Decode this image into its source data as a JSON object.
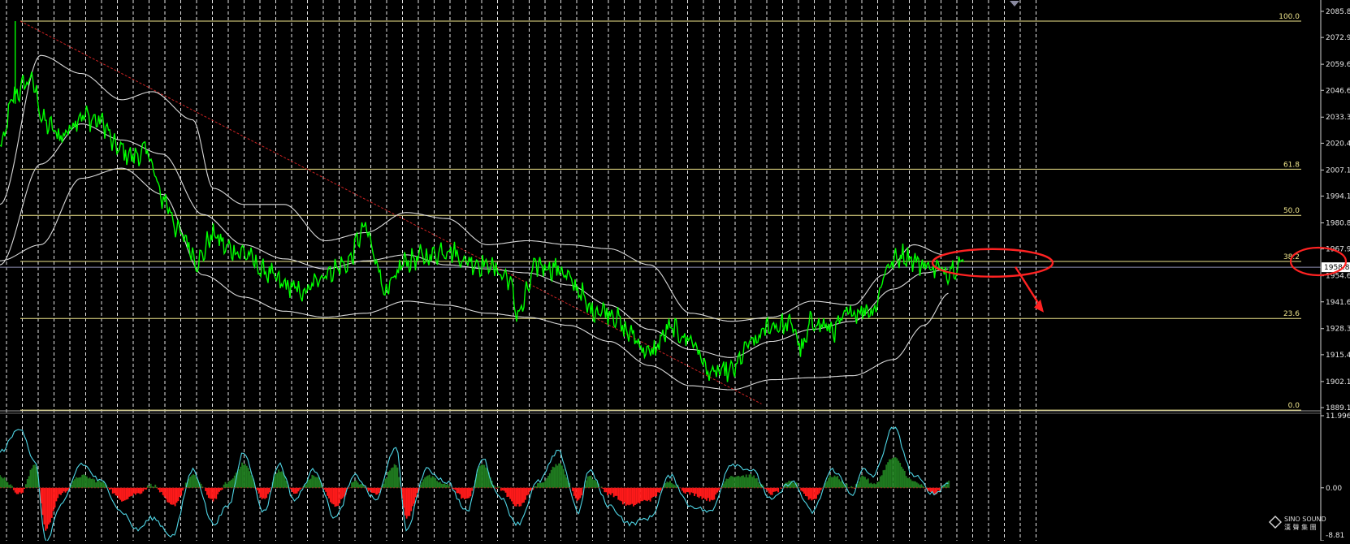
{
  "chart_data": [
    {
      "type": "line",
      "name": "price-panel",
      "ylim": [
        1889.15,
        2085.85
      ],
      "y_ticks": [
        "2085.85",
        "2072.90",
        "2059.60",
        "2046.65",
        "2033.35",
        "2020.40",
        "2007.10",
        "1994.15",
        "1980.85",
        "1967.90",
        "1954.60",
        "1941.65",
        "1928.35",
        "1915.40",
        "1902.10",
        "1889.15"
      ],
      "current_price": "1958.83",
      "fib_levels": [
        {
          "label": "100.0",
          "value": 2081.0
        },
        {
          "label": "61.8",
          "value": 2007.5
        },
        {
          "label": "50.0",
          "value": 1984.6
        },
        {
          "label": "38.2",
          "value": 1961.7
        },
        {
          "label": "23.6",
          "value": 1933.4
        },
        {
          "label": "0.0",
          "value": 1887.9
        }
      ],
      "trendline": {
        "from": [
          0,
          2081.0
        ],
        "to": [
          0.75,
          1891.0
        ]
      },
      "price_anchors": [
        [
          0.0,
          2018
        ],
        [
          0.015,
          2045
        ],
        [
          0.03,
          2052
        ],
        [
          0.045,
          2030
        ],
        [
          0.06,
          2024
        ],
        [
          0.08,
          2034
        ],
        [
          0.1,
          2031
        ],
        [
          0.115,
          2018
        ],
        [
          0.13,
          2014
        ],
        [
          0.145,
          2016
        ],
        [
          0.16,
          1993
        ],
        [
          0.18,
          1974
        ],
        [
          0.195,
          1962
        ],
        [
          0.21,
          1975
        ],
        [
          0.225,
          1968
        ],
        [
          0.24,
          1966
        ],
        [
          0.26,
          1957
        ],
        [
          0.28,
          1950
        ],
        [
          0.3,
          1946
        ],
        [
          0.32,
          1956
        ],
        [
          0.34,
          1960
        ],
        [
          0.36,
          1978
        ],
        [
          0.37,
          1963
        ],
        [
          0.38,
          1946
        ],
        [
          0.4,
          1962
        ],
        [
          0.42,
          1964
        ],
        [
          0.44,
          1968
        ],
        [
          0.46,
          1962
        ],
        [
          0.48,
          1960
        ],
        [
          0.5,
          1954
        ],
        [
          0.51,
          1936
        ],
        [
          0.53,
          1960
        ],
        [
          0.55,
          1958
        ],
        [
          0.57,
          1948
        ],
        [
          0.58,
          1938
        ],
        [
          0.6,
          1937
        ],
        [
          0.62,
          1926
        ],
        [
          0.64,
          1916
        ],
        [
          0.66,
          1928
        ],
        [
          0.68,
          1923
        ],
        [
          0.7,
          1906
        ],
        [
          0.72,
          1907
        ],
        [
          0.74,
          1921
        ],
        [
          0.76,
          1930
        ],
        [
          0.78,
          1930
        ],
        [
          0.79,
          1918
        ],
        [
          0.8,
          1932
        ],
        [
          0.82,
          1928
        ],
        [
          0.84,
          1937
        ],
        [
          0.86,
          1938
        ],
        [
          0.875,
          1960
        ],
        [
          0.89,
          1965
        ],
        [
          0.91,
          1960
        ],
        [
          0.93,
          1957
        ],
        [
          0.95,
          1962
        ]
      ],
      "bands_upper": [
        [
          0.0,
          1990
        ],
        [
          0.04,
          2064
        ],
        [
          0.08,
          2055
        ],
        [
          0.12,
          2042
        ],
        [
          0.15,
          2046
        ],
        [
          0.19,
          2032
        ],
        [
          0.21,
          1998
        ],
        [
          0.24,
          1990
        ],
        [
          0.28,
          1990
        ],
        [
          0.32,
          1972
        ],
        [
          0.36,
          1976
        ],
        [
          0.4,
          1986
        ],
        [
          0.44,
          1983
        ],
        [
          0.48,
          1970
        ],
        [
          0.52,
          1972
        ],
        [
          0.56,
          1970
        ],
        [
          0.6,
          1968
        ],
        [
          0.64,
          1960
        ],
        [
          0.68,
          1936
        ],
        [
          0.72,
          1932
        ],
        [
          0.76,
          1934
        ],
        [
          0.8,
          1942
        ],
        [
          0.84,
          1940
        ],
        [
          0.87,
          1955
        ],
        [
          0.9,
          1970
        ],
        [
          0.93,
          1965
        ]
      ],
      "bands_middle": [
        [
          0.0,
          1960
        ],
        [
          0.04,
          2010
        ],
        [
          0.08,
          2030
        ],
        [
          0.12,
          2022
        ],
        [
          0.16,
          2015
        ],
        [
          0.2,
          1985
        ],
        [
          0.24,
          1970
        ],
        [
          0.28,
          1963
        ],
        [
          0.32,
          1958
        ],
        [
          0.36,
          1962
        ],
        [
          0.4,
          1965
        ],
        [
          0.44,
          1960
        ],
        [
          0.48,
          1958
        ],
        [
          0.52,
          1956
        ],
        [
          0.56,
          1950
        ],
        [
          0.6,
          1940
        ],
        [
          0.64,
          1928
        ],
        [
          0.68,
          1918
        ],
        [
          0.72,
          1914
        ],
        [
          0.76,
          1922
        ],
        [
          0.8,
          1928
        ],
        [
          0.84,
          1932
        ],
        [
          0.88,
          1948
        ],
        [
          0.91,
          1956
        ],
        [
          0.935,
          1958
        ]
      ],
      "bands_lower": [
        [
          0.0,
          1962
        ],
        [
          0.04,
          1970
        ],
        [
          0.08,
          2003
        ],
        [
          0.12,
          2008
        ],
        [
          0.16,
          1995
        ],
        [
          0.2,
          1955
        ],
        [
          0.24,
          1944
        ],
        [
          0.28,
          1937
        ],
        [
          0.32,
          1934
        ],
        [
          0.36,
          1936
        ],
        [
          0.4,
          1942
        ],
        [
          0.44,
          1940
        ],
        [
          0.48,
          1936
        ],
        [
          0.52,
          1934
        ],
        [
          0.56,
          1930
        ],
        [
          0.6,
          1922
        ],
        [
          0.64,
          1910
        ],
        [
          0.68,
          1900
        ],
        [
          0.72,
          1898
        ],
        [
          0.76,
          1903
        ],
        [
          0.8,
          1904
        ],
        [
          0.84,
          1905
        ],
        [
          0.88,
          1913
        ],
        [
          0.91,
          1930
        ],
        [
          0.935,
          1946
        ]
      ]
    },
    {
      "type": "area",
      "name": "oscillator-panel",
      "ylim": [
        -8.81,
        11.996
      ],
      "y_ticks": [
        "11.996",
        "0.00",
        "-8.81"
      ],
      "hist_anchors": [
        [
          0.0,
          2
        ],
        [
          0.02,
          -1
        ],
        [
          0.035,
          4
        ],
        [
          0.045,
          -7
        ],
        [
          0.06,
          -1
        ],
        [
          0.08,
          2
        ],
        [
          0.1,
          1
        ],
        [
          0.12,
          -2
        ],
        [
          0.135,
          -1
        ],
        [
          0.15,
          0.5
        ],
        [
          0.17,
          -3
        ],
        [
          0.19,
          2
        ],
        [
          0.21,
          -2
        ],
        [
          0.225,
          1
        ],
        [
          0.24,
          4
        ],
        [
          0.26,
          -2
        ],
        [
          0.275,
          3
        ],
        [
          0.29,
          -1
        ],
        [
          0.31,
          2
        ],
        [
          0.33,
          -3
        ],
        [
          0.35,
          1
        ],
        [
          0.37,
          -1
        ],
        [
          0.39,
          4
        ],
        [
          0.4,
          -5
        ],
        [
          0.42,
          2
        ],
        [
          0.44,
          0.5
        ],
        [
          0.46,
          -2
        ],
        [
          0.475,
          4
        ],
        [
          0.49,
          0
        ],
        [
          0.51,
          -3
        ],
        [
          0.53,
          0.5
        ],
        [
          0.55,
          4
        ],
        [
          0.57,
          -2
        ],
        [
          0.58,
          2
        ],
        [
          0.6,
          -1
        ],
        [
          0.62,
          -3
        ],
        [
          0.64,
          -2
        ],
        [
          0.66,
          1
        ],
        [
          0.68,
          -1
        ],
        [
          0.7,
          -2
        ],
        [
          0.72,
          2
        ],
        [
          0.74,
          2
        ],
        [
          0.76,
          -1
        ],
        [
          0.78,
          1
        ],
        [
          0.8,
          -2
        ],
        [
          0.82,
          2
        ],
        [
          0.84,
          0
        ],
        [
          0.85,
          2
        ],
        [
          0.86,
          0.5
        ],
        [
          0.88,
          5
        ],
        [
          0.9,
          1
        ],
        [
          0.92,
          -1
        ],
        [
          0.935,
          1
        ]
      ],
      "signal_anchors": [
        [
          0.0,
          6
        ],
        [
          0.02,
          10
        ],
        [
          0.035,
          4
        ],
        [
          0.045,
          -9
        ],
        [
          0.06,
          -3
        ],
        [
          0.08,
          4
        ],
        [
          0.1,
          1
        ],
        [
          0.12,
          -4
        ],
        [
          0.135,
          -7
        ],
        [
          0.15,
          -5
        ],
        [
          0.17,
          -8
        ],
        [
          0.19,
          3
        ],
        [
          0.21,
          -6
        ],
        [
          0.225,
          -3
        ],
        [
          0.24,
          6
        ],
        [
          0.26,
          -4
        ],
        [
          0.275,
          4
        ],
        [
          0.29,
          -2
        ],
        [
          0.31,
          3
        ],
        [
          0.33,
          -5
        ],
        [
          0.35,
          2
        ],
        [
          0.37,
          -2
        ],
        [
          0.39,
          7
        ],
        [
          0.4,
          -7
        ],
        [
          0.42,
          3
        ],
        [
          0.44,
          1
        ],
        [
          0.46,
          -4
        ],
        [
          0.475,
          5
        ],
        [
          0.49,
          -1
        ],
        [
          0.51,
          -6
        ],
        [
          0.53,
          1
        ],
        [
          0.55,
          6
        ],
        [
          0.57,
          -4
        ],
        [
          0.58,
          3
        ],
        [
          0.6,
          -3
        ],
        [
          0.62,
          -6
        ],
        [
          0.64,
          -5
        ],
        [
          0.66,
          2
        ],
        [
          0.68,
          -3
        ],
        [
          0.7,
          -4
        ],
        [
          0.72,
          4
        ],
        [
          0.74,
          3
        ],
        [
          0.76,
          -2
        ],
        [
          0.78,
          1
        ],
        [
          0.8,
          -4
        ],
        [
          0.82,
          3
        ],
        [
          0.84,
          -1
        ],
        [
          0.85,
          3
        ],
        [
          0.86,
          2
        ],
        [
          0.88,
          10
        ],
        [
          0.9,
          2
        ],
        [
          0.92,
          -1
        ],
        [
          0.935,
          1
        ]
      ]
    }
  ],
  "logo": {
    "line1": "SINO SOUND",
    "line2": "漢 聲 集 團"
  },
  "colors": {
    "background": "#000000",
    "price": "#00ff00",
    "bands": "#d9d9d9",
    "fib": "#f0e68c",
    "trend": "#cc2222",
    "hist_pos": "#1f7a1f",
    "hist_neg": "#ff1a1a",
    "signal": "#4fd6e6",
    "grid": "#ffffff",
    "annotation": "#ff2222"
  }
}
